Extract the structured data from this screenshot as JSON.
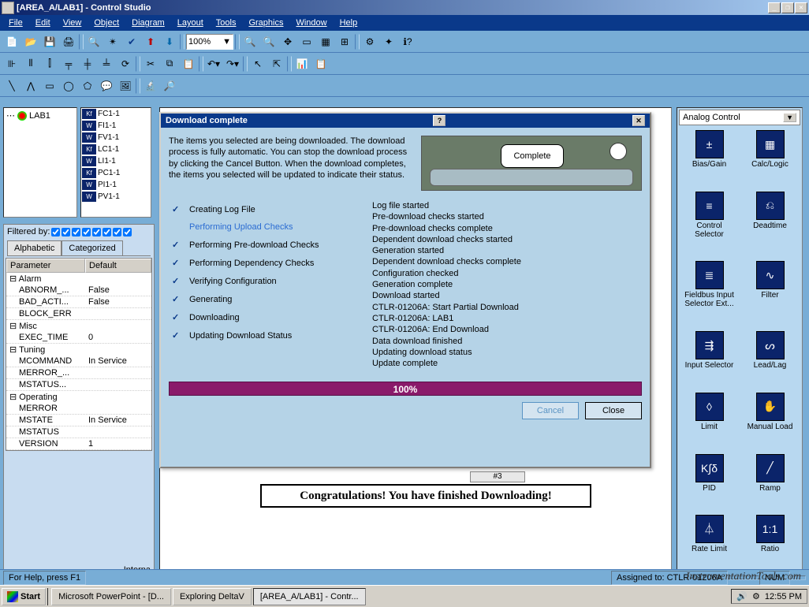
{
  "titlebar": {
    "title": "[AREA_A/LAB1] - Control Studio"
  },
  "menu": [
    "File",
    "Edit",
    "View",
    "Object",
    "Diagram",
    "Layout",
    "Tools",
    "Graphics",
    "Window",
    "Help"
  ],
  "zoom": "100%",
  "tree": {
    "root": "LAB1"
  },
  "sublist": [
    {
      "type": "Kf",
      "name": "FC1-1"
    },
    {
      "type": "W",
      "name": "FI1-1"
    },
    {
      "type": "W",
      "name": "FV1-1"
    },
    {
      "type": "Kf",
      "name": "LC1-1"
    },
    {
      "type": "W",
      "name": "LI1-1"
    },
    {
      "type": "Kf",
      "name": "PC1-1"
    },
    {
      "type": "W",
      "name": "PI1-1"
    },
    {
      "type": "W",
      "name": "PV1-1"
    }
  ],
  "filter": {
    "label": "Filtered by:"
  },
  "tabs": {
    "alpha": "Alphabetic",
    "cat": "Categorized"
  },
  "paramhdr": {
    "c1": "Parameter",
    "c2": "Default"
  },
  "params": [
    {
      "group": "⊟ Alarm"
    },
    {
      "name": "ABNORM_...",
      "val": "False"
    },
    {
      "name": "BAD_ACTI...",
      "val": "False"
    },
    {
      "name": "BLOCK_ERR",
      "val": ""
    },
    {
      "group": "⊟ Misc"
    },
    {
      "name": "EXEC_TIME",
      "val": "0"
    },
    {
      "group": "⊟ Tuning"
    },
    {
      "name": "MCOMMAND",
      "val": "In Service"
    },
    {
      "name": "MERROR_...",
      "val": ""
    },
    {
      "name": "MSTATUS...",
      "val": ""
    },
    {
      "group": "⊟ Operating"
    },
    {
      "name": "MERROR",
      "val": ""
    },
    {
      "name": "MSTATE",
      "val": "In Service"
    },
    {
      "name": "MSTATUS",
      "val": ""
    },
    {
      "name": "VERSION",
      "val": "1"
    }
  ],
  "interna": "Interna",
  "palette": {
    "header": "Analog Control",
    "items": [
      {
        "label": "Bias/Gain",
        "glyph": "±"
      },
      {
        "label": "Calc/Logic",
        "glyph": "▦"
      },
      {
        "label": "Control Selector",
        "glyph": "≡"
      },
      {
        "label": "Deadtime",
        "glyph": "⎌"
      },
      {
        "label": "Fieldbus Input Selector Ext...",
        "glyph": "≣"
      },
      {
        "label": "Filter",
        "glyph": "∿"
      },
      {
        "label": "Input Selector",
        "glyph": "⇶"
      },
      {
        "label": "Lead/Lag",
        "glyph": "ᔕ"
      },
      {
        "label": "Limit",
        "glyph": "◊"
      },
      {
        "label": "Manual Load",
        "glyph": "✋"
      },
      {
        "label": "PID",
        "glyph": "K∫δ"
      },
      {
        "label": "Ramp",
        "glyph": "╱"
      },
      {
        "label": "Rate Limit",
        "glyph": "⏃"
      },
      {
        "label": "Ratio",
        "glyph": "1:1"
      }
    ]
  },
  "dialog": {
    "title": "Download complete",
    "text": "The items you selected are being downloaded.  The download process is fully automatic.  You can stop the download process by clicking the Cancel Button.  When the download completes, the items you selected will be updated to indicate their status.",
    "bubble": "Complete",
    "checklist": [
      {
        "done": true,
        "label": "Creating Log File"
      },
      {
        "done": false,
        "current": true,
        "label": "Performing Upload Checks"
      },
      {
        "done": true,
        "label": "Performing Pre-download Checks"
      },
      {
        "done": true,
        "label": "Performing Dependency Checks"
      },
      {
        "done": true,
        "label": "Verifying Configuration"
      },
      {
        "done": true,
        "label": "Generating"
      },
      {
        "done": true,
        "label": "Downloading"
      },
      {
        "done": true,
        "label": "Updating Download Status"
      }
    ],
    "log": [
      "Log file started",
      "Pre-download checks started",
      "Pre-download checks complete",
      "Dependent download checks started",
      "Generation started",
      "Dependent download checks complete",
      "Configuration checked",
      "Generation complete",
      "Download started",
      "CTLR-01206A: Start Partial Download",
      "CTLR-01206A: LAB1",
      "CTLR-01206A: End Download",
      "Data download finished",
      "Updating download status",
      "Update complete"
    ],
    "progress": "100%",
    "cancel": "Cancel",
    "close": "Close"
  },
  "banner": "Congratulations! You have finished Downloading!",
  "hash3": "#3",
  "status": {
    "help": "For Help, press F1",
    "assigned": "Assigned to: CTLR-01206A",
    "num": "NUM"
  },
  "taskbar": {
    "start": "Start",
    "tasks": [
      "Microsoft PowerPoint - [D...",
      "Exploring DeltaV",
      "[AREA_A/LAB1] - Contr..."
    ],
    "time": "12:55 PM"
  },
  "watermark": "InstrumentationTools.com"
}
